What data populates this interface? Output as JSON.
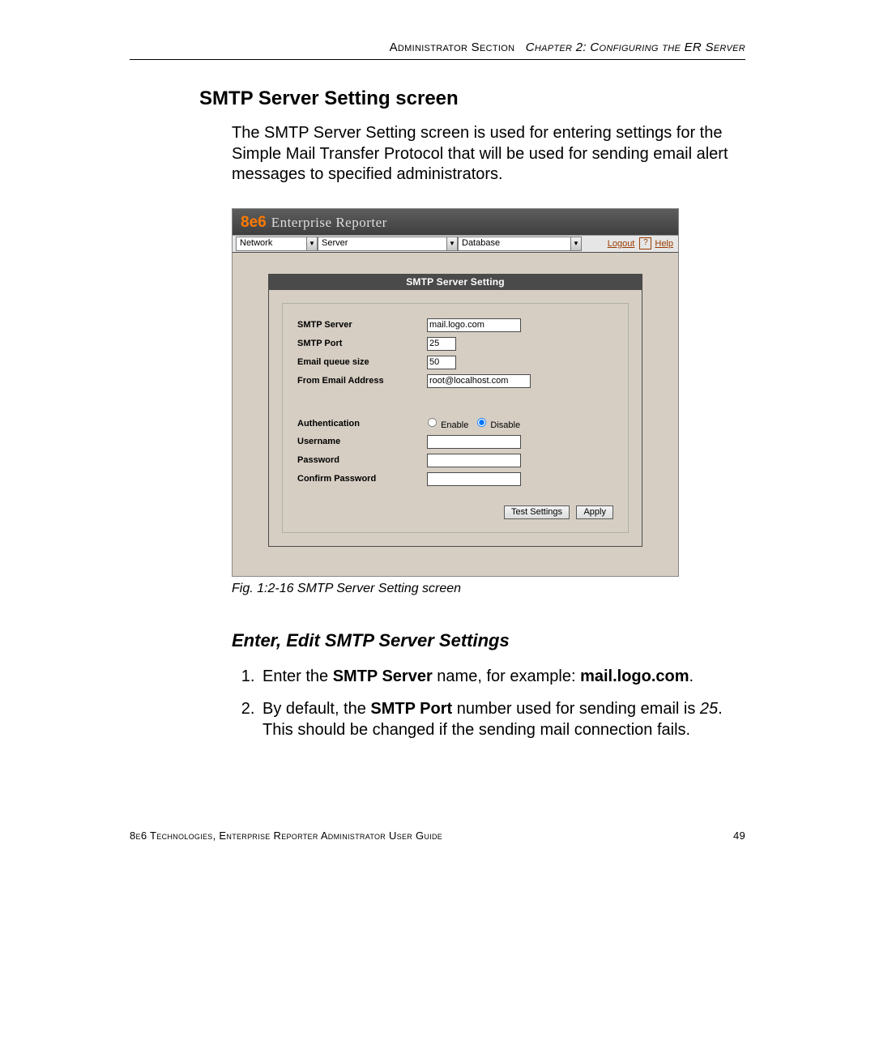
{
  "header": {
    "left": "Administrator Section",
    "right_italic": "Chapter 2: Configuring the ER Server"
  },
  "section_title": "SMTP Server Setting screen",
  "intro": "The SMTP Server Setting screen is used for entering settings for the Simple Mail Transfer Protocol that will be used for sending email alert messages to specified administrators.",
  "app": {
    "brand_num": "8e6",
    "brand_text": "Enterprise Reporter",
    "menus": {
      "network": "Network",
      "server": "Server",
      "database": "Database"
    },
    "links": {
      "logout": "Logout",
      "help_q": "?",
      "help": "Help"
    },
    "panel_title": "SMTP Server Setting",
    "fields": {
      "smtp_server_label": "SMTP Server",
      "smtp_server_value": "mail.logo.com",
      "smtp_port_label": "SMTP Port",
      "smtp_port_value": "25",
      "queue_label": "Email queue size",
      "queue_value": "50",
      "from_label": "From Email Address",
      "from_value": "root@localhost.com",
      "auth_label": "Authentication",
      "enable": "Enable",
      "disable": "Disable",
      "username_label": "Username",
      "password_label": "Password",
      "confirm_label": "Confirm Password"
    },
    "buttons": {
      "test": "Test Settings",
      "apply": "Apply"
    }
  },
  "caption": "Fig. 1:2-16  SMTP Server Setting screen",
  "subsection_title": "Enter, Edit SMTP Server Settings",
  "steps": {
    "s1_a": "Enter the ",
    "s1_b": "SMTP Server",
    "s1_c": " name, for example: ",
    "s1_d": "mail.logo.com",
    "s1_e": ".",
    "s2_a": "By default, the ",
    "s2_b": "SMTP Port",
    "s2_c": " number used for sending email is ",
    "s2_d": "25",
    "s2_e": ". This should be changed if the sending mail connection fails."
  },
  "footer": {
    "left": "8e6 Technologies, Enterprise Reporter Administrator User Guide",
    "right": "49"
  }
}
